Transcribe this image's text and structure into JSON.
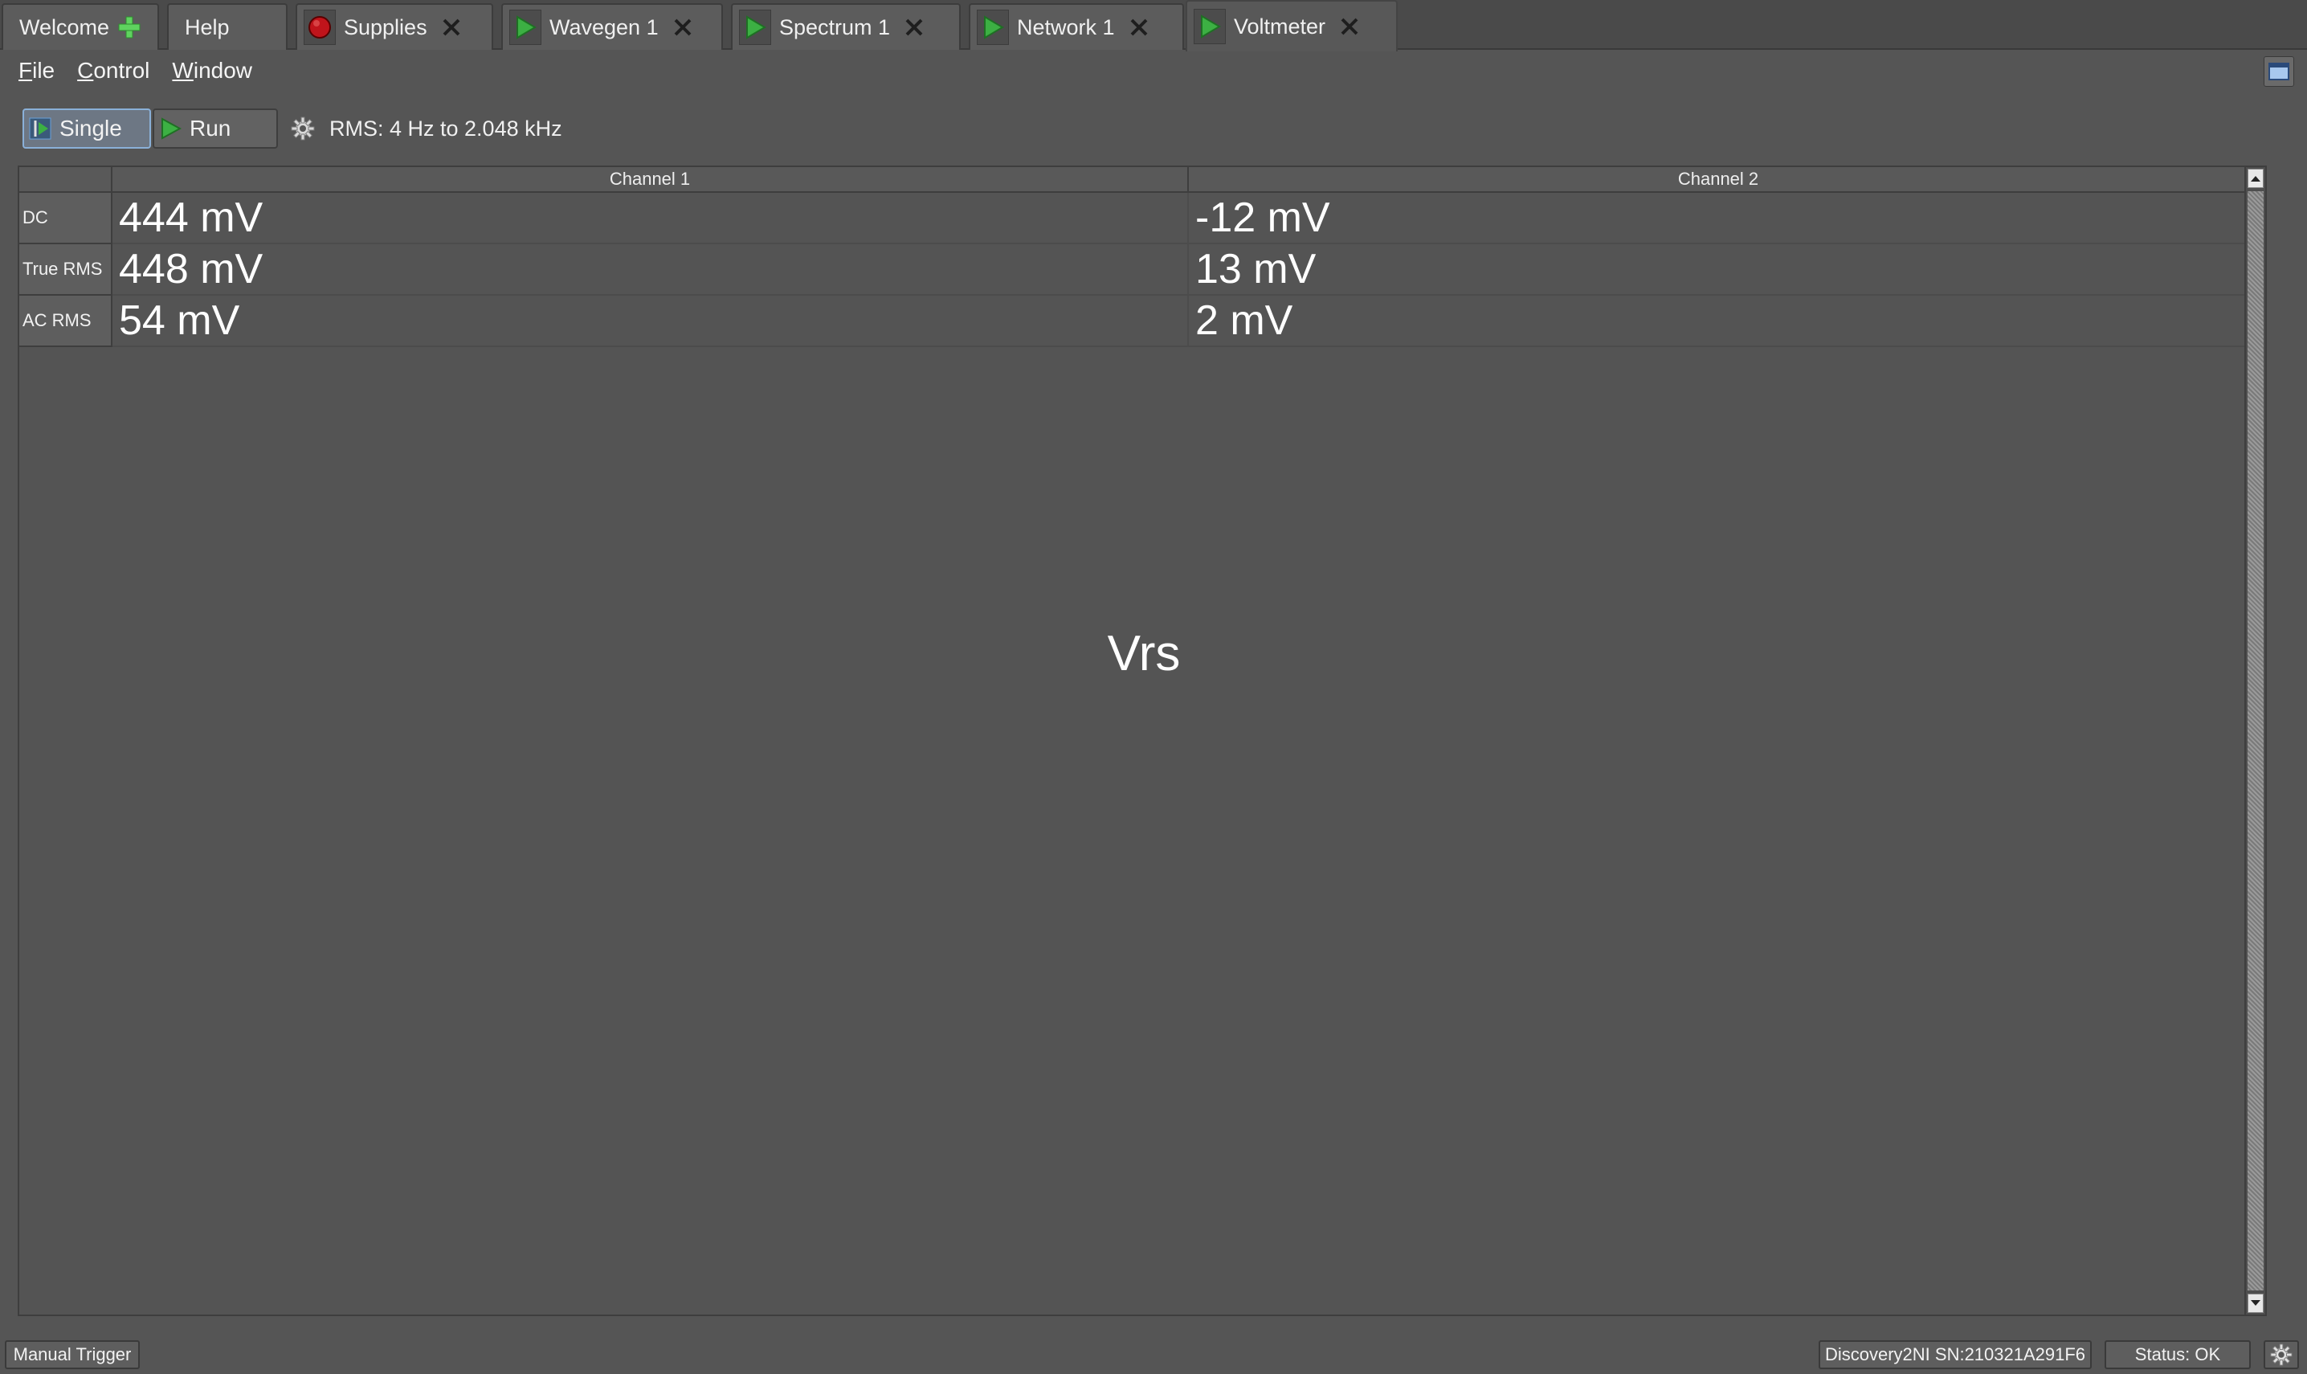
{
  "tabs": [
    {
      "label": "Welcome",
      "icon": "plus-icon",
      "closable": false
    },
    {
      "label": "Help",
      "icon": "",
      "closable": false
    },
    {
      "label": "Supplies",
      "icon": "stop-icon",
      "closable": true
    },
    {
      "label": "Wavegen 1",
      "icon": "play-icon",
      "closable": true
    },
    {
      "label": "Spectrum 1",
      "icon": "play-icon",
      "closable": true
    },
    {
      "label": "Network 1",
      "icon": "play-icon",
      "closable": true
    },
    {
      "label": "Voltmeter",
      "icon": "play-icon",
      "closable": true,
      "active": true
    }
  ],
  "menu": {
    "file": {
      "first": "F",
      "rest": "ile"
    },
    "control": {
      "first": "C",
      "rest": "ontrol"
    },
    "window": {
      "first": "W",
      "rest": "indow"
    }
  },
  "toolbar": {
    "single_label": "Single",
    "run_label": "Run",
    "rms_text": "RMS: 4 Hz to 2.048 kHz"
  },
  "table": {
    "columns": [
      "Channel 1",
      "Channel 2"
    ],
    "rows": [
      {
        "label": "DC",
        "values": [
          "444 mV",
          "-12 mV"
        ]
      },
      {
        "label": "True RMS",
        "values": [
          "448 mV",
          "13 mV"
        ]
      },
      {
        "label": "AC RMS",
        "values": [
          "54 mV",
          "2 mV"
        ]
      }
    ],
    "center_label": "Vrs"
  },
  "status": {
    "manual_trigger": "Manual Trigger",
    "device": "Discovery2NI SN:210321A291F6",
    "status_text": "Status: OK"
  },
  "colors": {
    "background": "#555555",
    "play_green": "#3cb043",
    "stop_red": "#c0141b",
    "plus_green": "#5fd35f",
    "single_highlight": "#8ab0d8"
  }
}
